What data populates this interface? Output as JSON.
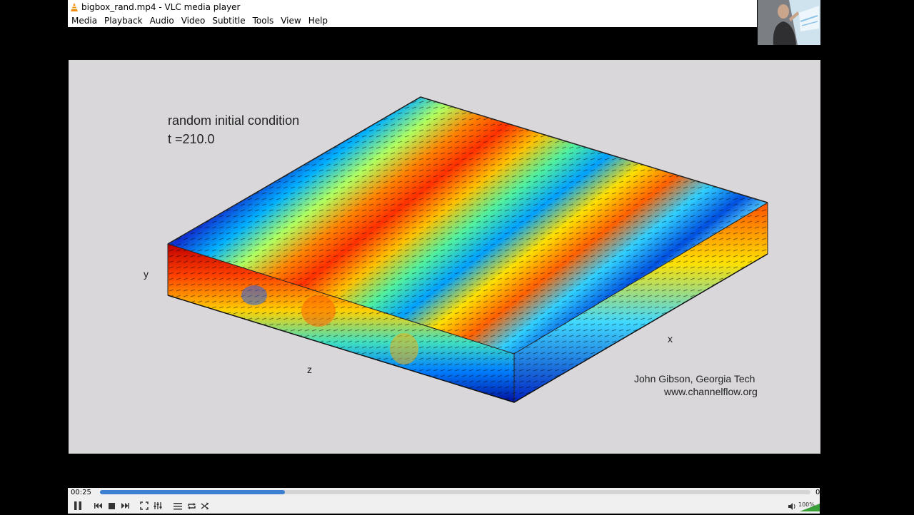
{
  "window": {
    "title": "bigbox_rand.mp4 - VLC media player"
  },
  "menu": [
    "Media",
    "Playback",
    "Audio",
    "Video",
    "Subtitle",
    "Tools",
    "View",
    "Help"
  ],
  "video": {
    "caption_line1": "random initial condition",
    "caption_line2": "t =210.0",
    "axis_y": "y",
    "axis_z": "z",
    "axis_x": "x",
    "credit_line1": "John Gibson, Georgia Tech",
    "credit_line2": "www.channelflow.org",
    "colormap": [
      "#00007f",
      "#0000ff",
      "#00bfff",
      "#7fff7f",
      "#ffff00",
      "#ff7f00",
      "#ff0000",
      "#7f0000"
    ]
  },
  "player": {
    "time_elapsed": "00:25",
    "time_total": "0",
    "progress_fraction": 0.26,
    "volume_label": "100%",
    "accent_color": "#3d7fd1",
    "buttons": [
      "pause-icon",
      "previous-icon",
      "stop-icon",
      "next-icon",
      "fullscreen-icon",
      "extended-settings-icon",
      "playlist-icon",
      "loop-icon",
      "shuffle-icon"
    ]
  }
}
